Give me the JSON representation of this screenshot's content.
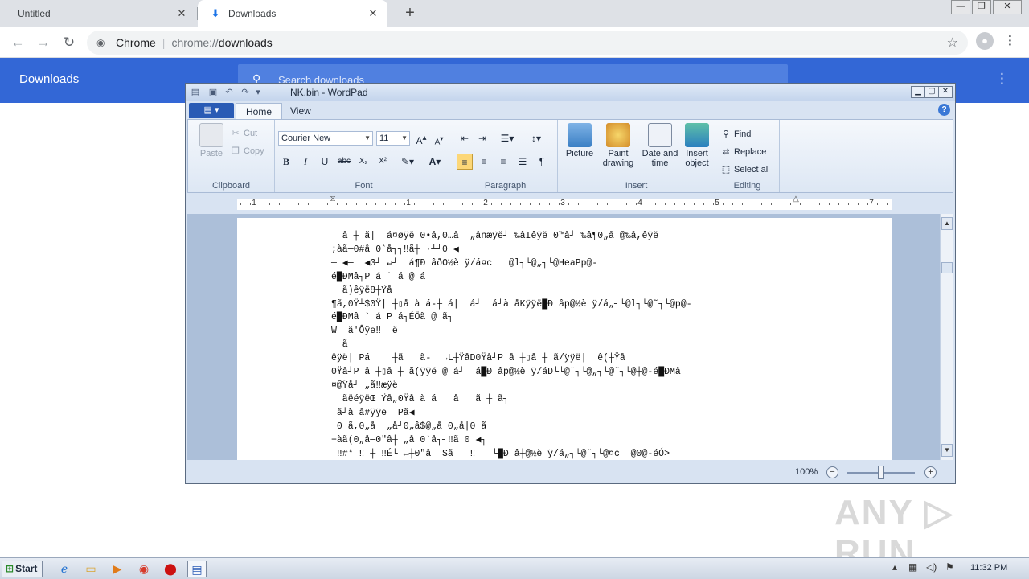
{
  "browser": {
    "tabs": [
      {
        "label": "Untitled",
        "close": "✕"
      },
      {
        "label": "Downloads",
        "close": "✕"
      }
    ],
    "new_tab": "+",
    "omnibox": {
      "site": "Chrome",
      "separator": "|",
      "scheme": "chrome://",
      "path": "downloads"
    },
    "window_controls": {
      "minimize": "—",
      "maximize": "❐",
      "close": "✕"
    }
  },
  "downloads_page": {
    "title": "Downloads",
    "search_placeholder": "Search downloads"
  },
  "wordpad": {
    "title": "NK.bin - WordPad",
    "ribbon_tabs": [
      "Home",
      "View"
    ],
    "clipboard": {
      "paste": "Paste",
      "cut": "Cut",
      "copy": "Copy",
      "label": "Clipboard"
    },
    "font": {
      "family": "Courier New",
      "size": "11",
      "label": "Font"
    },
    "paragraph": {
      "label": "Paragraph"
    },
    "insert": {
      "picture": "Picture",
      "paint_drawing": "Paint drawing",
      "date_time": "Date and time",
      "insert_object": "Insert object",
      "label": "Insert"
    },
    "editing": {
      "find": "Find",
      "replace": "Replace",
      "select_all": "Select all",
      "label": "Editing"
    },
    "ruler_numbers": [
      "1",
      "1",
      "2",
      "3",
      "4",
      "5",
      "7"
    ],
    "document_lines": [
      "  å ┼ ã|  á¤øÿë 0•å,0…å  „ânæÿë┘ ‰âIêÿë 0™å┘ ‰â¶0„å @‰å,êÿë",
      ";àã─0#â 0‵å┐┐‼ã┼ ·┴┘0 ◀",
      "┼ ◀─  ◀3┘ ↵┘  á¶Ð âðO½è ÿ/á¤c   @l┐└@„┐└@HeaPp@-",
      "é█ÐMâ┐P á ` á @ á",
      "  ã)êÿë8┼Ÿå",
      "¶ã,0Ÿ┴$0Ÿ| ┼▯å à á-┼ á|  á┘  á┘à åKÿÿë█Ð âp@½è ÿ/á„┐└@l┐└@˜┐└@p@-",
      "é█ÐMâ ` á P á┐ÉÖã @ ã┐",
      "W  ã'Ôÿe‼  ê",
      "  ã",
      "êÿë| Pá    ┼ã   ã-  →L┼ŸåD0Ÿå┘P å ┼▯å ┼ ã/ÿÿë|  ê(┼Ÿå",
      "0Ÿå┘P å ┼▯å ┼ ã(ÿÿë @ á┘  á█Ð âp@½è ÿ/áD└└@¨┐└@„┐└@˜┐└@┼@-é█ÐMâ",
      "¤@Ÿå┘ „ã‼æÿë",
      "  ãëéÿëŒ Ÿå„0Ÿå à á   å   ã ┼ ã┐",
      " ã┘à å#ÿÿe  Pã◀",
      " 0 ã,0„å  „å┘0„â$@„å 0„å|0 ã",
      "+àã(0„å─0″â┼ „å 0‵å┐┐‼ã 0 ◀┐",
      " ‼#* ‼ ┼ ‼É└ ←┼0″å  Sã   ‼   └█Ð â┼@½è ÿ/á„┐└@˜┐└@¤c  @0@-éÓ>"
    ],
    "zoom": "100%"
  },
  "watermark": "ANY ▷ RUN",
  "taskbar": {
    "start": "Start",
    "clock": "11:32 PM"
  }
}
